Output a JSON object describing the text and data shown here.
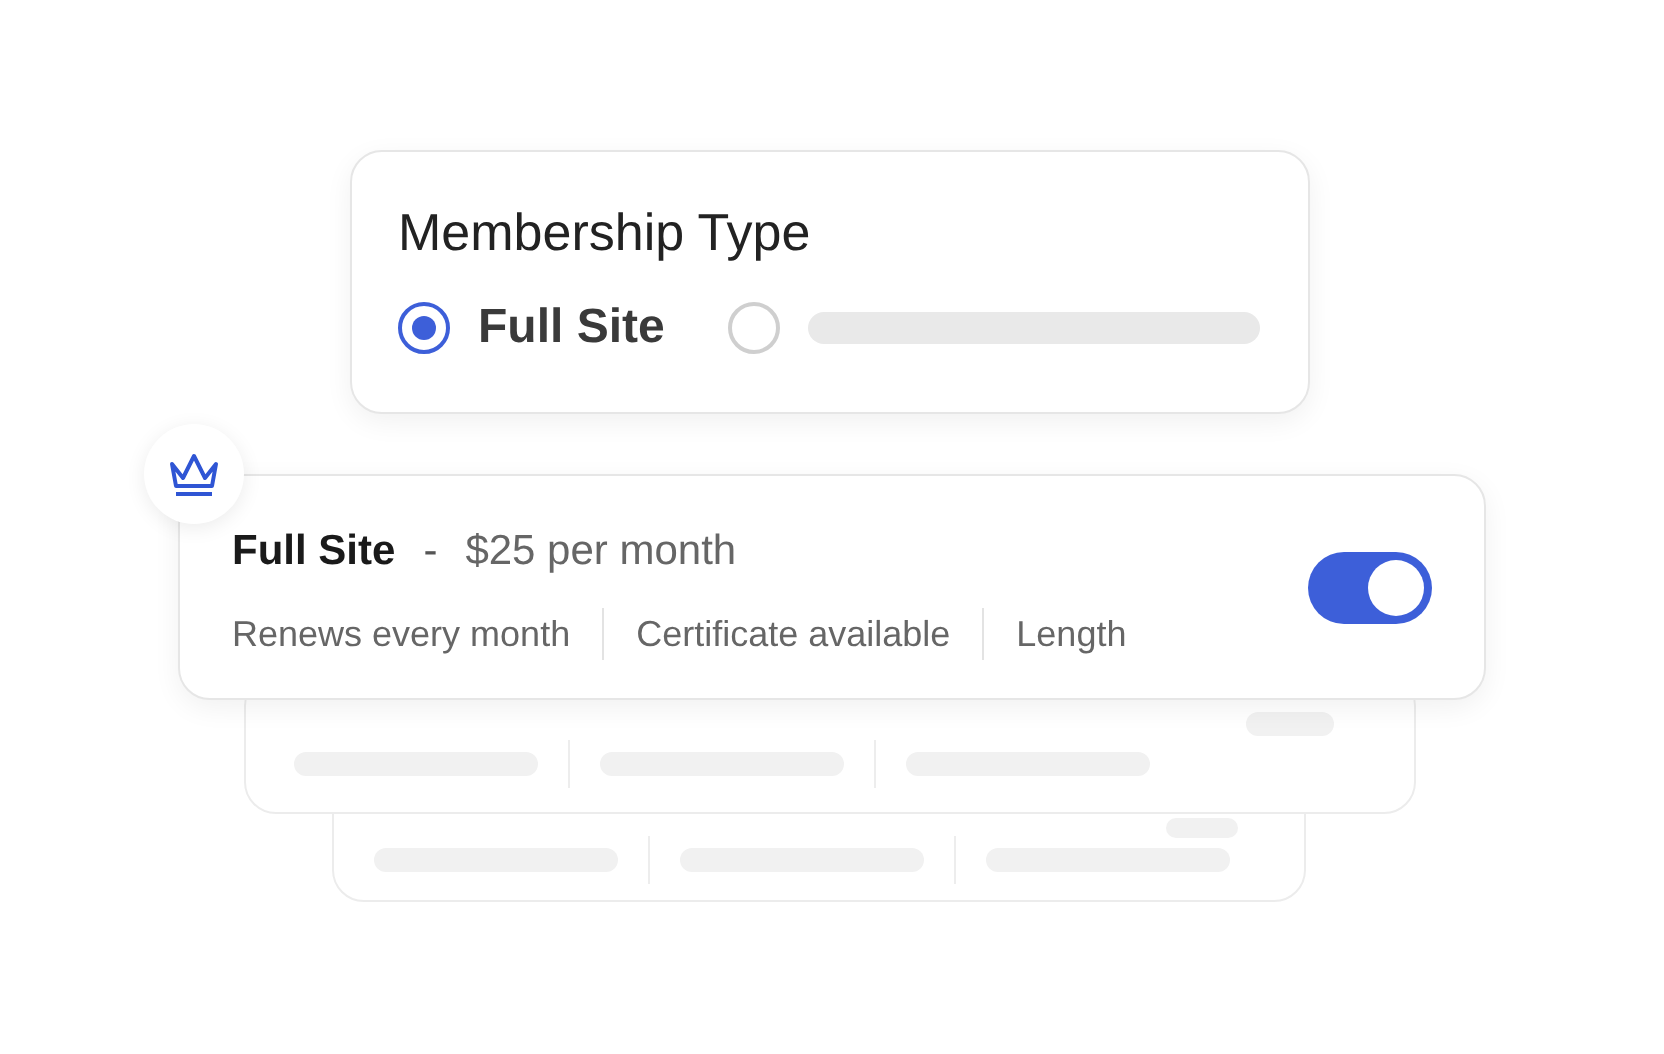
{
  "membership": {
    "title": "Membership Type",
    "options": [
      {
        "label": "Full Site",
        "selected": true
      },
      {
        "selected": false
      }
    ]
  },
  "plan": {
    "name": "Full Site",
    "separator": "-",
    "price": "$25 per month",
    "features": [
      "Renews every month",
      "Certificate available",
      "Length"
    ],
    "on": true
  }
}
